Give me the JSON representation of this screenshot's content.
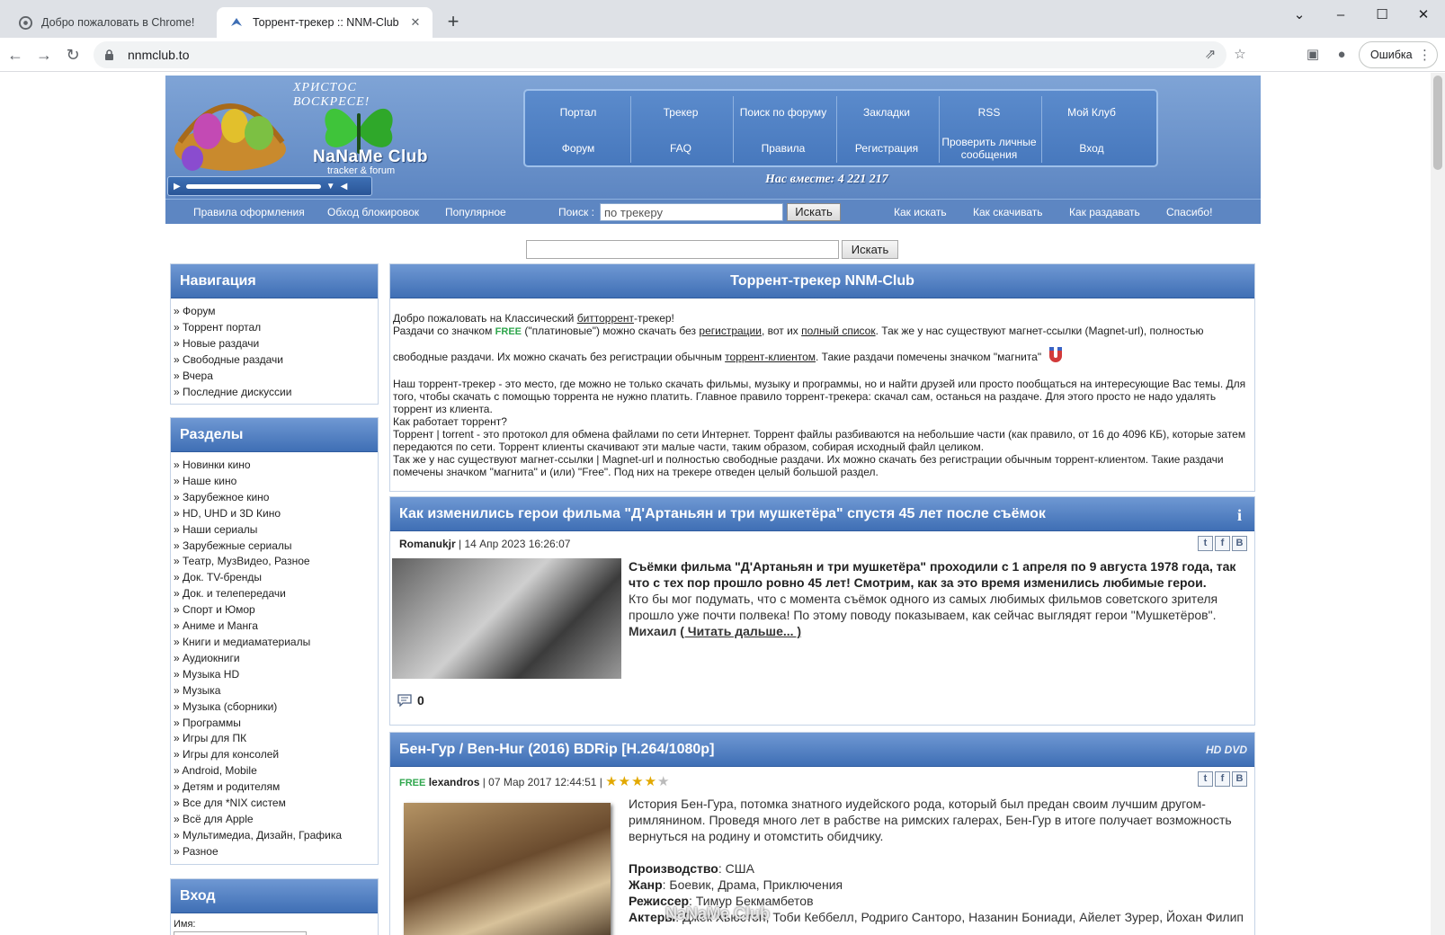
{
  "browser": {
    "tabs": [
      {
        "title": "Добро пожаловать в Chrome!"
      },
      {
        "title": "Торрент-трекер :: NNM-Club"
      }
    ],
    "url": "nnmclub.to",
    "error_button": "Ошибка"
  },
  "header": {
    "motto": "ХРИСТОС ВОСКРЕСЕ!",
    "brand": "NaNaMe Club",
    "brand_sub": "tracker & forum",
    "menu": [
      "Портал",
      "Трекер",
      "Поиск по форуму",
      "Закладки",
      "RSS",
      "Мой Клуб",
      "Форум",
      "FAQ",
      "Правила",
      "Регистрация",
      "Проверить личные сообщения",
      "Вход"
    ],
    "together": "Нас вместе: 4 221 217"
  },
  "subnav": {
    "links_left": [
      "Правила оформления",
      "Обход блокировок",
      "Популярное"
    ],
    "search_label": "Поиск :",
    "search_value": "по трекеру",
    "search_button": "Искать",
    "links_right": [
      "Как искать",
      "Как скачивать",
      "Как раздавать",
      "Спасибо!"
    ]
  },
  "search2_button": "Искать",
  "sidebar": {
    "nav_title": "Навигация",
    "nav_items": [
      "Форум",
      "Торрент портал",
      "Новые раздачи",
      "Свободные раздачи",
      "Вчера",
      "Последние дискуссии"
    ],
    "sections_title": "Разделы",
    "sections": [
      "Новинки кино",
      "Наше кино",
      "Зарубежное кино",
      "HD, UHD и 3D Кино",
      "Наши сериалы",
      "Зарубежные сериалы",
      "Театр, МузВидео, Разное",
      "Док. TV-бренды",
      "Док. и телепередачи",
      "Спорт и Юмор",
      "Аниме и Манга",
      "Книги и медиаматериалы",
      "Аудиокниги",
      "Музыка HD",
      "Музыка",
      "Музыка (сборники)",
      "Программы",
      "Игры для ПК",
      "Игры для консолей",
      "Android, Mobile",
      "Детям и родителям",
      "Все для *NIX систем",
      "Всё для Apple",
      "Мультимедиа, Дизайн, Графика",
      "Разное"
    ],
    "login_title": "Вход",
    "login_name_label": "Имя:"
  },
  "welcome": {
    "title": "Торрент-трекер NNM-Club",
    "l1a": "Добро пожаловать на Классический ",
    "l1b": "битторрент",
    "l1c": "-трекер!",
    "l2a": "Раздачи со значком ",
    "free": "FREE",
    "l2b": " (\"платиновые\") можно скачать без ",
    "l2c": "регистрации",
    "l2d": ", вот их ",
    "l2e": "полный список",
    "l2f": ". Так же у нас существуют магнет-ссылки (Magnet-url), полностью",
    "l3a": "свободные раздачи. Их можно скачать без регистрации обычным ",
    "l3b": "торрент-клиентом",
    "l3c": ". Такие раздачи помечены значком \"магнита\"",
    "p2": "Наш торрент-трекер - это место, где можно не только скачать фильмы, музыку и программы, но и найти друзей или просто пообщаться на интересующие Вас темы. Для того, чтобы скачать с помощью торрента не нужно платить. Главное правило торрент-трекера: скачал сам, останься на раздаче. Для этого просто не надо удалять торрент из клиента.",
    "p3": "Как работает торрент?",
    "p4": "Торрент | torrent - это протокол для обмена файлами по сети Интернет. Торрент файлы разбиваются на небольшие части (как правило, от 16 до 4096 КБ), которые затем передаются по сети. Торрент клиенты скачивают эти малые части, таким образом, собирая исходный файл целиком.",
    "p5": "Так же у нас существуют магнет-ссылки | Magnet-url и полностью свободные раздачи. Их можно скачать без регистрации обычным торрент-клиентом. Такие раздачи помечены значком \"магнита\" и (или) \"Free\". Под них на трекере отведен целый большой раздел."
  },
  "news": {
    "title": "Как изменились герои фильма \"Д'Артаньян и три мушкетёра\" спустя 45 лет после съёмок",
    "author": "Romanukjr",
    "date": "| 14 Апр 2023 16:26:07",
    "lead": "Съёмки фильма \"Д'Артаньян и три мушкетёра\" проходили с 1 апреля по 9 августа 1978 года, так что с тех пор прошло ровно 45 лет! Смотрим, как за это время изменились любимые герои.",
    "text": "Кто бы мог подумать, что с момента съёмок одного из самых любимых фильмов советского зрителя прошло уже почти полвека! По этому поводу показываем, как сейчас выглядят герои \"Мушкетёров\".",
    "signature": "Михаил",
    "read_more": "( Читать дальше... )",
    "comments": "0"
  },
  "movie": {
    "title": "Бен-Гур / Ben-Hur (2016) BDRip [H.264/1080p]",
    "badge": "HD DVD",
    "free": "FREE",
    "author": "lexandros",
    "date": "| 07 Мар 2017 12:44:51 |",
    "rating": 4,
    "description": "История Бен-Гура, потомка знатного иудейского рода, который был предан своим лучшим другом-римлянином. Проведя много лет в рабстве на римских галерах, Бен-Гур в итоге получает возможность вернуться на родину и отомстить обидчику.",
    "production_label": "Производство",
    "production": ": США",
    "genre_label": "Жанр",
    "genre": ": Боевик, Драма, Приключения",
    "director_label": "Режиссер",
    "director": ": Тимур Бекмамбетов",
    "cast_label": "Актеры",
    "cast": ": Джек Хьюстон, Тоби Кеббелл, Родриго Санторо, Назанин Бониади, Айелет Зурер, Йохан Филип"
  },
  "watermark": "NaNaMe Club",
  "colors": {
    "header_blue": "#5d86c2",
    "box_header": "#3f6fb5",
    "free_green": "#2ea64c",
    "star": "#e2a800"
  }
}
